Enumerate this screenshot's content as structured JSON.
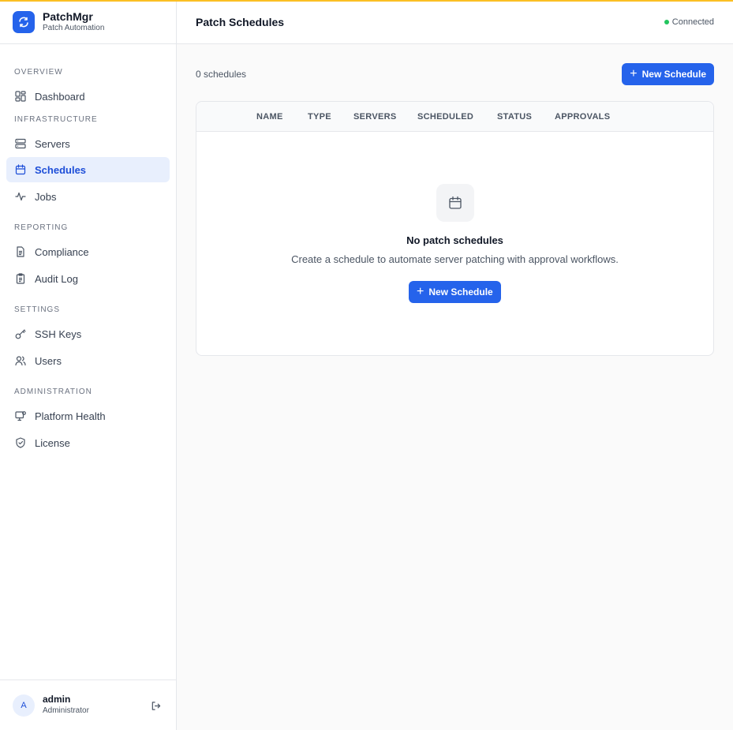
{
  "brand": {
    "title": "PatchMgr",
    "subtitle": "Patch Automation",
    "accent": "#2563eb"
  },
  "sidebar": {
    "sections": [
      {
        "label": "OVERVIEW"
      },
      {
        "label": "INFRASTRUCTURE"
      },
      {
        "label": "REPORTING"
      },
      {
        "label": "SETTINGS"
      },
      {
        "label": "ADMINISTRATION"
      }
    ],
    "items": [
      {
        "label": "Dashboard",
        "icon": "dashboard-icon"
      },
      {
        "label": "Servers",
        "icon": "server-icon"
      },
      {
        "label": "Schedules",
        "icon": "calendar-icon",
        "active": true
      },
      {
        "label": "Jobs",
        "icon": "activity-icon"
      },
      {
        "label": "Compliance",
        "icon": "document-icon"
      },
      {
        "label": "Audit Log",
        "icon": "clipboard-icon"
      },
      {
        "label": "SSH Keys",
        "icon": "key-icon"
      },
      {
        "label": "Users",
        "icon": "users-icon"
      },
      {
        "label": "Platform Health",
        "icon": "monitor-icon"
      },
      {
        "label": "License",
        "icon": "shield-icon"
      }
    ]
  },
  "user": {
    "initial": "A",
    "name": "admin",
    "role": "Administrator"
  },
  "header": {
    "title": "Patch Schedules",
    "status": "Connected",
    "status_color": "#22c55e"
  },
  "toolbar": {
    "count": "0 schedules",
    "new_label": "New Schedule"
  },
  "table": {
    "columns": [
      "NAME",
      "TYPE",
      "SERVERS",
      "SCHEDULED",
      "STATUS",
      "APPROVALS"
    ]
  },
  "empty": {
    "title": "No patch schedules",
    "description": "Create a schedule to automate server patching with approval workflows.",
    "button_label": "New Schedule"
  }
}
